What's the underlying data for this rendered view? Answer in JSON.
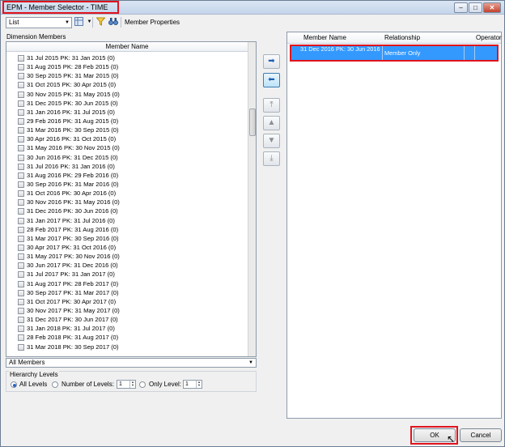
{
  "window": {
    "title": "EPM  - Member Selector - TIME",
    "controls": [
      "–",
      "□",
      "✕"
    ]
  },
  "toolbar": {
    "view_select": "List",
    "member_properties_label": "Member Properties"
  },
  "left_panel": {
    "heading": "Dimension Members",
    "column_header": "Member Name",
    "members": [
      "31 Jul 2015  PK: 31 Jan 2015 (0)",
      "31 Aug 2015  PK: 28 Feb 2015 (0)",
      "30 Sep 2015  PK: 31 Mar 2015 (0)",
      "31 Oct 2015  PK: 30 Apr 2015 (0)",
      "30 Nov 2015  PK: 31 May 2015 (0)",
      "31 Dec 2015  PK: 30 Jun 2015 (0)",
      "31 Jan 2016  PK: 31 Jul 2015 (0)",
      "29 Feb 2016  PK: 31 Aug 2015 (0)",
      "31 Mar 2016  PK: 30 Sep 2015 (0)",
      "30 Apr 2016  PK: 31 Oct 2015 (0)",
      "31 May 2016  PK: 30 Nov 2015 (0)",
      "30 Jun 2016  PK: 31 Dec 2015 (0)",
      "31 Jul 2016  PK: 31 Jan 2016 (0)",
      "31 Aug 2016  PK: 29 Feb 2016 (0)",
      "30 Sep 2016  PK: 31 Mar 2016 (0)",
      "31 Oct 2016  PK: 30 Apr 2016 (0)",
      "30 Nov 2016  PK: 31 May 2016 (0)",
      "31 Dec 2016  PK: 30 Jun 2016 (0)",
      "31 Jan 2017  PK: 31 Jul 2016 (0)",
      "28 Feb 2017  PK: 31 Aug 2016 (0)",
      "31 Mar 2017  PK: 30 Sep 2016 (0)",
      "30 Apr 2017  PK: 31 Oct 2016 (0)",
      "31 May 2017  PK: 30 Nov 2016 (0)",
      "30 Jun 2017  PK: 31 Dec 2016 (0)",
      "31 Jul 2017  PK: 31 Jan 2017 (0)",
      "31 Aug 2017  PK: 28 Feb 2017 (0)",
      "30 Sep 2017  PK: 31 Mar 2017 (0)",
      "31 Oct 2017  PK: 30 Apr 2017 (0)",
      "30 Nov 2017  PK: 31 May 2017 (0)",
      "31 Dec 2017  PK: 30 Jun 2017 (0)",
      "31 Jan 2018  PK: 31 Jul 2017 (0)",
      "28 Feb 2018  PK: 31 Aug 2017 (0)",
      "31 Mar 2018  PK: 30 Sep 2017 (0)"
    ],
    "filter_select": "All Members",
    "hierarchy_levels": {
      "heading": "Hierarchy Levels",
      "all_levels_label": "All Levels",
      "number_of_levels_label": "Number of Levels:",
      "number_of_levels_value": "1",
      "only_level_label": "Only Level:",
      "only_level_value": "1",
      "selected_option": "All Levels"
    }
  },
  "right_panel": {
    "columns": [
      "Member Name",
      "Relationship",
      "Operator"
    ],
    "selected_members": [
      {
        "member_name": "31 Dec 2016  PK: 30 Jun 2016",
        "relationship": "Member Only",
        "operator": ""
      }
    ]
  },
  "buttons": {
    "ok": "OK",
    "cancel": "Cancel"
  },
  "icons": {
    "add": "arrow-right-icon",
    "remove": "arrow-left-icon",
    "move_top": "move-top-icon",
    "move_up": "move-up-icon",
    "move_down": "move-down-icon",
    "move_bottom": "move-bottom-icon"
  }
}
